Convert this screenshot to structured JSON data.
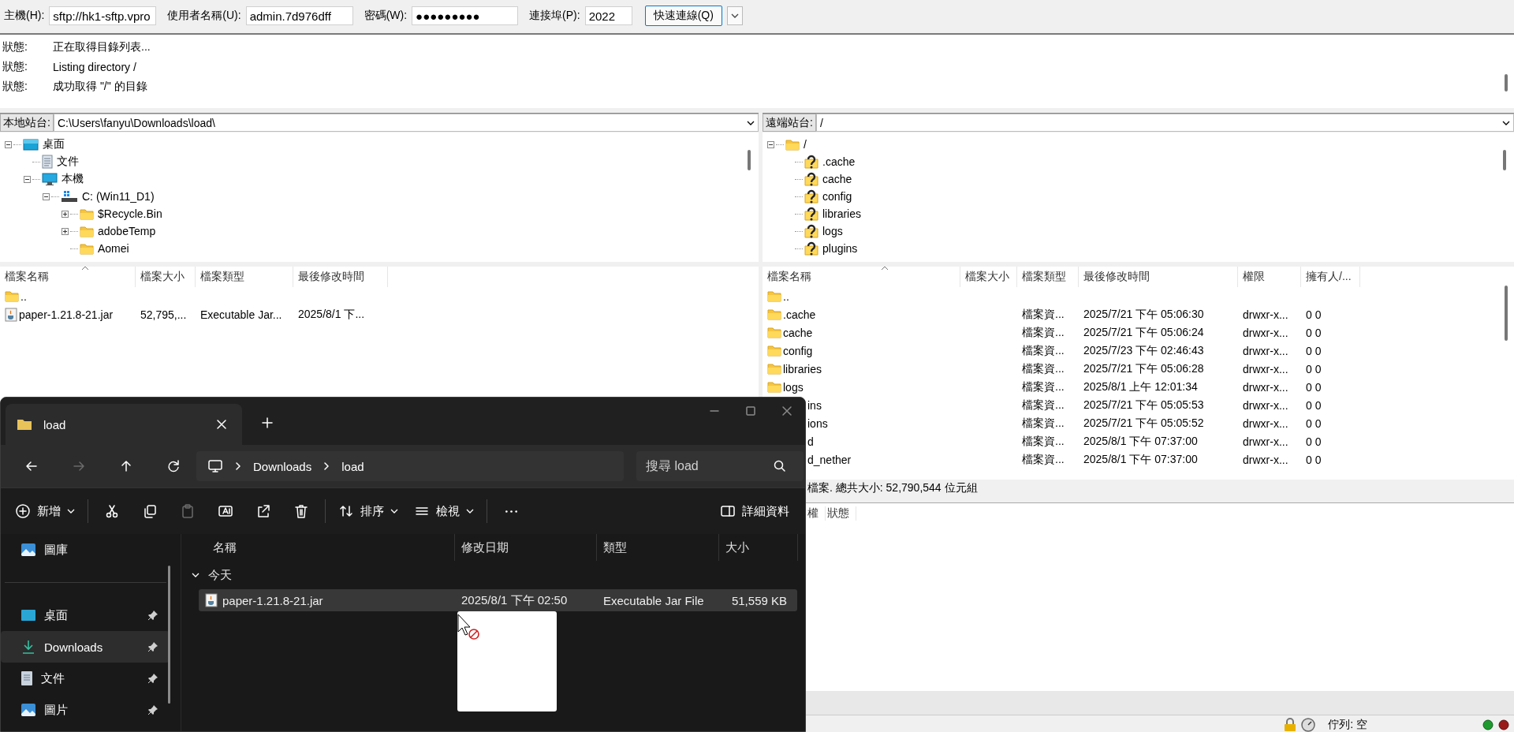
{
  "quick_connect": {
    "fields": [
      {
        "label": "主機(H):",
        "value": "sftp://hk1-sftp.vpro"
      },
      {
        "label": "使用者名稱(U):",
        "value": "admin.7d976dff"
      },
      {
        "label": "密碼(W):",
        "value": "●●●●●●●●●"
      },
      {
        "label": "連接埠(P):",
        "value": "2022"
      }
    ],
    "button": "快速連線(Q)"
  },
  "message_log": [
    {
      "label": "狀態:",
      "text": "正在取得目錄列表..."
    },
    {
      "label": "狀態:",
      "text": "Listing directory /"
    },
    {
      "label": "狀態:",
      "text": "成功取得 \"/\" 的目錄"
    }
  ],
  "local": {
    "site_label": "本地站台:",
    "path": "C:\\Users\\fanyu\\Downloads\\load\\",
    "tree": [
      {
        "label": "桌面",
        "kind": "desktop",
        "expanded": true,
        "children": [
          {
            "label": "文件",
            "kind": "document"
          },
          {
            "label": "本機",
            "kind": "computer",
            "expanded": true,
            "children": [
              {
                "label": "C: (Win11_D1)",
                "kind": "drive",
                "expanded": true,
                "children": [
                  {
                    "label": "$Recycle.Bin",
                    "kind": "folder",
                    "expanded": false
                  },
                  {
                    "label": "adobeTemp",
                    "kind": "folder",
                    "expanded": false
                  },
                  {
                    "label": "Aomei",
                    "kind": "folder"
                  }
                ]
              }
            ]
          }
        ]
      }
    ],
    "columns": [
      "檔案名稱",
      "檔案大小",
      "檔案類型",
      "最後修改時間"
    ],
    "rows": [
      {
        "kind": "parent",
        "name": ".."
      },
      {
        "kind": "jar",
        "name": "paper-1.21.8-21.jar",
        "size": "52,795,...",
        "type": "Executable Jar...",
        "modified": "2025/8/1 下..."
      }
    ]
  },
  "remote": {
    "site_label": "遠端站台:",
    "path": "/",
    "tree": [
      {
        "label": "/",
        "kind": "folder",
        "expanded": true,
        "children": [
          {
            "label": ".cache",
            "kind": "unknown"
          },
          {
            "label": "cache",
            "kind": "unknown"
          },
          {
            "label": "config",
            "kind": "unknown"
          },
          {
            "label": "libraries",
            "kind": "unknown"
          },
          {
            "label": "logs",
            "kind": "unknown"
          },
          {
            "label": "plugins",
            "kind": "unknown"
          }
        ]
      }
    ],
    "columns": [
      "檔案名稱",
      "檔案大小",
      "檔案類型",
      "最後修改時間",
      "權限",
      "擁有人/..."
    ],
    "rows": [
      {
        "kind": "parent",
        "name": ".."
      },
      {
        "kind": "folder",
        "name": ".cache",
        "type": "檔案資...",
        "modified": "2025/7/21 下午 05:06:30",
        "permissions": "drwxr-x...",
        "owner": "0 0"
      },
      {
        "kind": "folder",
        "name": "cache",
        "type": "檔案資...",
        "modified": "2025/7/21 下午 05:06:24",
        "permissions": "drwxr-x...",
        "owner": "0 0"
      },
      {
        "kind": "folder",
        "name": "config",
        "type": "檔案資...",
        "modified": "2025/7/23 下午 02:46:43",
        "permissions": "drwxr-x...",
        "owner": "0 0"
      },
      {
        "kind": "folder",
        "name": "libraries",
        "type": "檔案資...",
        "modified": "2025/7/21 下午 05:06:28",
        "permissions": "drwxr-x...",
        "owner": "0 0"
      },
      {
        "kind": "folder",
        "name": "logs",
        "type": "檔案資...",
        "modified": "2025/8/1 上午 12:01:34",
        "permissions": "drwxr-x...",
        "owner": "0 0"
      },
      {
        "kind": "clipped",
        "name": "ins",
        "type": "檔案資...",
        "modified": "2025/7/21 下午 05:05:53",
        "permissions": "drwxr-x...",
        "owner": "0 0"
      },
      {
        "kind": "clipped",
        "name": "ions",
        "type": "檔案資...",
        "modified": "2025/7/21 下午 05:05:52",
        "permissions": "drwxr-x...",
        "owner": "0 0"
      },
      {
        "kind": "clipped",
        "name": "d",
        "type": "檔案資...",
        "modified": "2025/8/1 下午 07:37:00",
        "permissions": "drwxr-x...",
        "owner": "0 0"
      },
      {
        "kind": "clipped",
        "name": "d_nether",
        "type": "檔案資...",
        "modified": "2025/8/1 下午 07:37:00",
        "permissions": "drwxr-x...",
        "owner": "0 0"
      }
    ],
    "status": "檔案. 總共大小: 52,790,544 位元組"
  },
  "queue": {
    "columns": [
      "權",
      "狀態"
    ]
  },
  "status_bar": {
    "queue": "佇列: 空"
  },
  "file_explorer": {
    "tab": "load",
    "nav": [
      {
        "kind": "back",
        "disabled": false
      },
      {
        "kind": "forward",
        "disabled": true
      },
      {
        "kind": "up",
        "disabled": false
      },
      {
        "kind": "refresh",
        "disabled": false
      }
    ],
    "breadcrumb": [
      "Downloads",
      "load"
    ],
    "search_placeholder": "搜尋 load",
    "commands": [
      {
        "kind": "new",
        "label": "新增",
        "disabled": false
      },
      {
        "kind": "cut",
        "disabled": false
      },
      {
        "kind": "copy",
        "disabled": false
      },
      {
        "kind": "paste",
        "disabled": true
      },
      {
        "kind": "rename",
        "disabled": false
      },
      {
        "kind": "share",
        "disabled": false
      },
      {
        "kind": "delete",
        "disabled": false
      },
      {
        "kind": "sort",
        "label": "排序",
        "disabled": false
      },
      {
        "kind": "view",
        "label": "檢視",
        "disabled": false
      },
      {
        "kind": "more",
        "disabled": false
      },
      {
        "kind": "details",
        "label": "詳細資料",
        "disabled": false
      }
    ],
    "sidebar": [
      {
        "label": "圖庫",
        "kind": "gallery",
        "pinned": false,
        "selected": false
      },
      {
        "label": "桌面",
        "kind": "desktop",
        "pinned": true,
        "selected": false
      },
      {
        "label": "Downloads",
        "kind": "downloads",
        "pinned": true,
        "selected": true
      },
      {
        "label": "文件",
        "kind": "document",
        "pinned": true,
        "selected": false
      },
      {
        "label": "圖片",
        "kind": "pictures",
        "pinned": true,
        "selected": false
      }
    ],
    "columns": [
      "名稱",
      "修改日期",
      "類型",
      "大小"
    ],
    "group": {
      "label": "今天",
      "expanded": true
    },
    "files": [
      {
        "name": "paper-1.21.8-21.jar",
        "modified": "2025/8/1 下午 02:50",
        "type": "Executable Jar File",
        "size": "51,559 KB",
        "selected": true
      }
    ]
  }
}
